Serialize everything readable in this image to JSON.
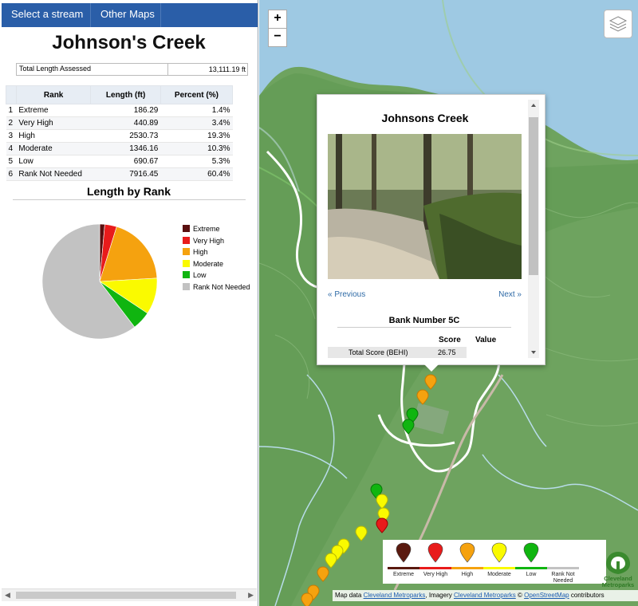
{
  "nav": {
    "stream_label": "Select a stream",
    "maps_label": "Other Maps"
  },
  "panel": {
    "title": "Johnson's Creek",
    "total_label": "Total Length Assessed",
    "total_value": "13,111.19 ft",
    "table": {
      "headers": [
        "",
        "Rank",
        "Length (ft)",
        "Percent (%)"
      ],
      "rows": [
        [
          "1",
          "Extreme",
          "186.29",
          "1.4%"
        ],
        [
          "2",
          "Very High",
          "440.89",
          "3.4%"
        ],
        [
          "3",
          "High",
          "2530.73",
          "19.3%"
        ],
        [
          "4",
          "Moderate",
          "1346.16",
          "10.3%"
        ],
        [
          "5",
          "Low",
          "690.67",
          "5.3%"
        ],
        [
          "6",
          "Rank Not Needed",
          "7916.45",
          "60.4%"
        ]
      ]
    }
  },
  "chart_data": {
    "type": "pie",
    "title": "Length by Rank",
    "categories": [
      "Extreme",
      "Very High",
      "High",
      "Moderate",
      "Low",
      "Rank Not Needed"
    ],
    "values": [
      186.29,
      440.89,
      2530.73,
      1346.16,
      690.67,
      7916.45
    ],
    "colors": [
      "#5a0f0f",
      "#e81b1b",
      "#f5a20f",
      "#fafa00",
      "#10b510",
      "#c2c2c2"
    ],
    "legend": "right"
  },
  "map": {
    "zoom_in": "+",
    "zoom_out": "−",
    "popup": {
      "title": "Johnsons Creek",
      "prev": "« Previous",
      "next": "Next »",
      "bank": "Bank Number 5C",
      "score_header": "Score",
      "value_header": "Value",
      "row_label": "Total Score (BEHI)",
      "row_score": "26.75"
    },
    "legend": {
      "items": [
        {
          "label": "Extreme",
          "color": "#5a1a0f"
        },
        {
          "label": "Very High",
          "color": "#e81b1b"
        },
        {
          "label": "High",
          "color": "#f5a20f"
        },
        {
          "label": "Moderate",
          "color": "#fafa00"
        },
        {
          "label": "Low",
          "color": "#10b510"
        },
        {
          "label": "Rank Not Needed",
          "color": "#c2c2c2"
        }
      ]
    },
    "attribution": {
      "prefix": "Map data ",
      "data_link": "Cleveland Metroparks",
      "imagery_prefix": ", Imagery ",
      "imagery_link": "Cleveland Metroparks",
      "osm_prefix": " © ",
      "osm_link": "OpenStreetMap",
      "suffix": " contributors"
    },
    "logo_text_1": "Cleveland",
    "logo_text_2": "Metroparks"
  }
}
